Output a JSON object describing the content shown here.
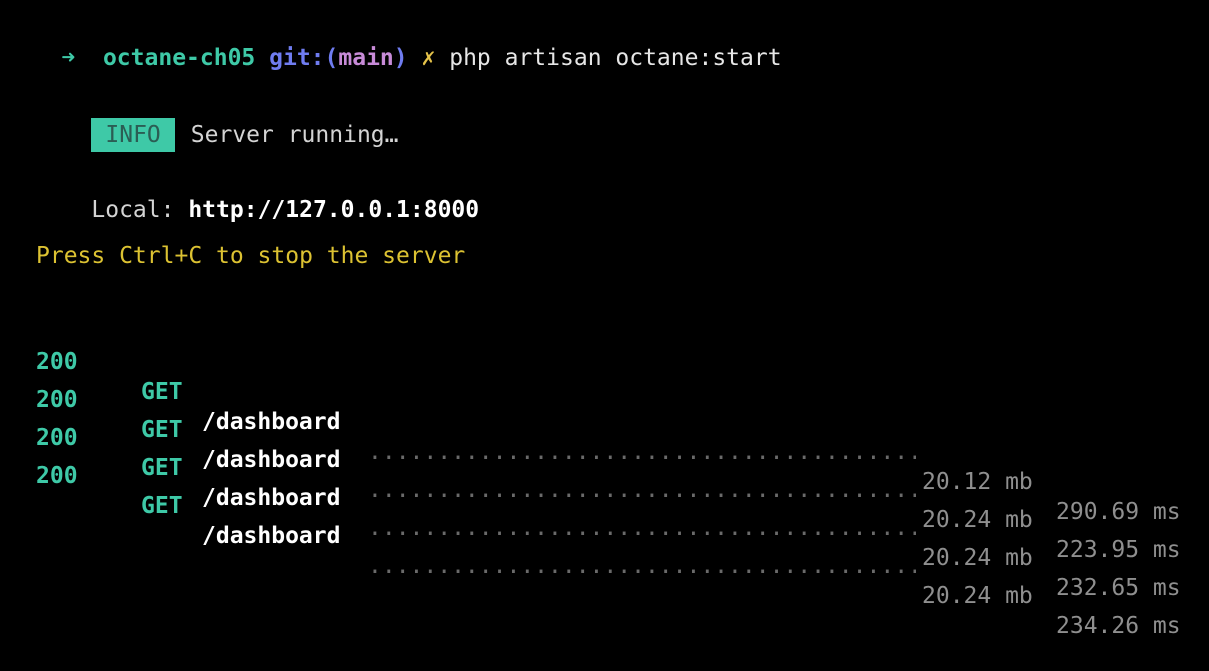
{
  "prompt": {
    "arrow": "➜",
    "directory": "octane-ch05",
    "git_label": "git:(",
    "branch": "main",
    "git_close": ")",
    "dirty_marker": "✗",
    "command": "php artisan octane:start"
  },
  "info": {
    "badge": "INFO",
    "message": "Server running…"
  },
  "local": {
    "label": "Local: ",
    "url": "http://127.0.0.1:8000"
  },
  "hint": "Press Ctrl+C to stop the server",
  "requests": [
    {
      "status": "200",
      "method": "GET",
      "path": "/dashboard",
      "memory": "20.12 mb",
      "duration": "290.69 ms"
    },
    {
      "status": "200",
      "method": "GET",
      "path": "/dashboard",
      "memory": "20.24 mb",
      "duration": "223.95 ms"
    },
    {
      "status": "200",
      "method": "GET",
      "path": "/dashboard",
      "memory": "20.24 mb",
      "duration": "232.65 ms"
    },
    {
      "status": "200",
      "method": "GET",
      "path": "/dashboard",
      "memory": "20.24 mb",
      "duration": "234.26 ms"
    }
  ],
  "colors": {
    "background": "#000000",
    "accent_green": "#3ec9a7",
    "git_blue": "#6f7cf0",
    "dirty_yellow": "#e5c34a",
    "hint_yellow": "#dcc232"
  }
}
